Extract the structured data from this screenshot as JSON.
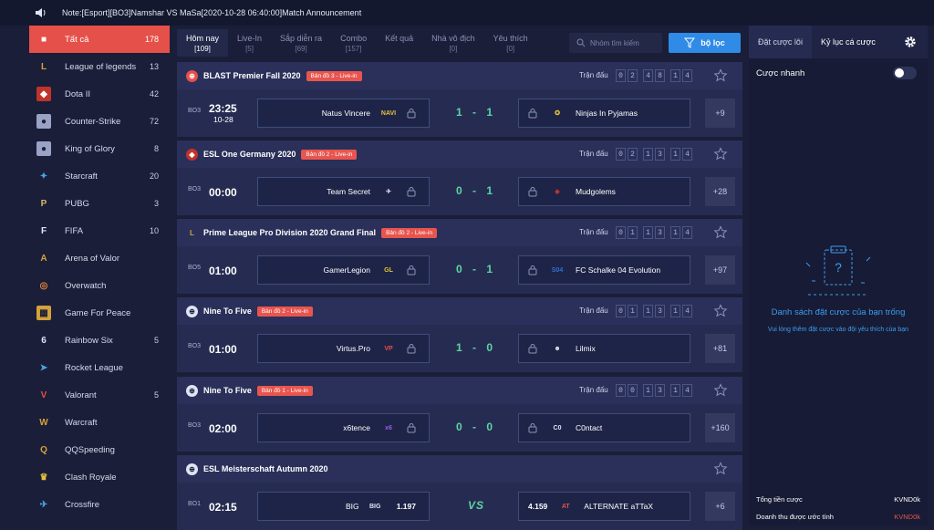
{
  "announcement": "Note:[Esport][BO3]Namshar VS MaSa[2020-10-28 06:40:00]Match Announcement",
  "sidebar": {
    "items": [
      {
        "label": "Tất cả",
        "count": "178",
        "icon": "all-games-icon",
        "active": true
      },
      {
        "label": "League of legends",
        "count": "13",
        "icon": "lol-icon"
      },
      {
        "label": "Dota II",
        "count": "42",
        "icon": "dota-icon"
      },
      {
        "label": "Counter-Strike",
        "count": "72",
        "icon": "csgo-icon"
      },
      {
        "label": "King of Glory",
        "count": "8",
        "icon": "king-of-glory-icon"
      },
      {
        "label": "Starcraft",
        "count": "20",
        "icon": "starcraft-icon"
      },
      {
        "label": "PUBG",
        "count": "3",
        "icon": "pubg-icon"
      },
      {
        "label": "FIFA",
        "count": "10",
        "icon": "fifa-icon"
      },
      {
        "label": "Arena of Valor",
        "count": "",
        "icon": "arena-of-valor-icon"
      },
      {
        "label": "Overwatch",
        "count": "",
        "icon": "overwatch-icon"
      },
      {
        "label": "Game For Peace",
        "count": "",
        "icon": "game-for-peace-icon"
      },
      {
        "label": "Rainbow Six",
        "count": "5",
        "icon": "rainbow-six-icon"
      },
      {
        "label": "Rocket League",
        "count": "",
        "icon": "rocket-league-icon"
      },
      {
        "label": "Valorant",
        "count": "5",
        "icon": "valorant-icon"
      },
      {
        "label": "Warcraft",
        "count": "",
        "icon": "warcraft-icon"
      },
      {
        "label": "QQSpeeding",
        "count": "",
        "icon": "qqspeeding-icon"
      },
      {
        "label": "Clash Royale",
        "count": "",
        "icon": "clash-royale-icon"
      },
      {
        "label": "Crossfire",
        "count": "",
        "icon": "crossfire-icon"
      }
    ]
  },
  "tabs": [
    {
      "label": "Hôm nay",
      "count": "[109]",
      "active": true
    },
    {
      "label": "Live-In",
      "count": "[5]"
    },
    {
      "label": "Sắp diễn ra",
      "count": "[69]"
    },
    {
      "label": "Combo",
      "count": "[157]"
    },
    {
      "label": "Kết quả",
      "count": ""
    },
    {
      "label": "Nhà vô địch",
      "count": "[0]"
    },
    {
      "label": "Yêu thích",
      "count": "[0]"
    }
  ],
  "search": {
    "placeholder": "Nhóm tìm kiếm"
  },
  "filter_label": "bộ lọc",
  "round_label": "Trận đấu",
  "matches": [
    {
      "league": "BLAST Premier Fall 2020",
      "badge": "Bản đồ 3 - Live-in",
      "timer": [
        "0",
        "2",
        "4",
        "8",
        "1",
        "4"
      ],
      "format": "BO3",
      "time": "23:25",
      "date": "10-28",
      "home": "Natus Vincere",
      "away": "Ninjas In Pyjamas",
      "score": "1 - 1",
      "more": "+9"
    },
    {
      "league": "ESL One Germany 2020",
      "badge": "Bản đồ 2 - Live-in",
      "timer": [
        "0",
        "2",
        "1",
        "3",
        "1",
        "4"
      ],
      "format": "BO3",
      "time": "00:00",
      "date": "",
      "home": "Team Secret",
      "away": "Mudgolems",
      "score": "0 - 1",
      "more": "+28"
    },
    {
      "league": "Prime League Pro Division 2020 Grand Final",
      "badge": "Bản đồ 2 - Live-in",
      "timer": [
        "0",
        "1",
        "1",
        "3",
        "1",
        "4"
      ],
      "format": "BO5",
      "time": "01:00",
      "date": "",
      "home": "GamerLegion",
      "away": "FC Schalke 04 Evolution",
      "score": "0 - 1",
      "more": "+97"
    },
    {
      "league": "Nine To Five",
      "badge": "Bản đồ 2 - Live-in",
      "timer": [
        "0",
        "1",
        "1",
        "3",
        "1",
        "4"
      ],
      "format": "BO3",
      "time": "01:00",
      "date": "",
      "home": "Virtus.Pro",
      "away": "Lilmix",
      "score": "1 - 0",
      "more": "+81"
    },
    {
      "league": "Nine To Five",
      "badge": "Bản đồ 1 - Live-in",
      "timer": [
        "0",
        "0",
        "1",
        "3",
        "1",
        "4"
      ],
      "format": "BO3",
      "time": "02:00",
      "date": "",
      "home": "x6tence",
      "away": "C0ntact",
      "score": "0 - 0",
      "more": "+160"
    },
    {
      "league": "ESL Meisterschaft Autumn 2020",
      "badge": "",
      "timer": [],
      "format": "BO1",
      "time": "02:15",
      "date": "",
      "home": "BIG",
      "away": "ALTERNATE aTTaX",
      "home_odds": "1.197",
      "away_odds": "4.159",
      "vs": "VS",
      "more": "+6"
    }
  ],
  "right_panel": {
    "tab_bets": "Đặt cược lôi",
    "tab_history": "Kỷ lục cá cược",
    "quick_bet": "Cược nhanh",
    "empty_title": "Danh sách đặt cược của bạn trống",
    "empty_sub": "Vui lòng thêm đặt cược vào đội yêu thích của bạn",
    "total_bet_label": "Tổng tiền cược",
    "total_bet_value": "KVND0k",
    "expected_win_label": "Doanh thu được ước tính",
    "expected_win_value": "KVND0k"
  },
  "colors": {
    "accent": "#e6504a",
    "blue": "#2f8be6",
    "score": "#5cd6a2"
  }
}
